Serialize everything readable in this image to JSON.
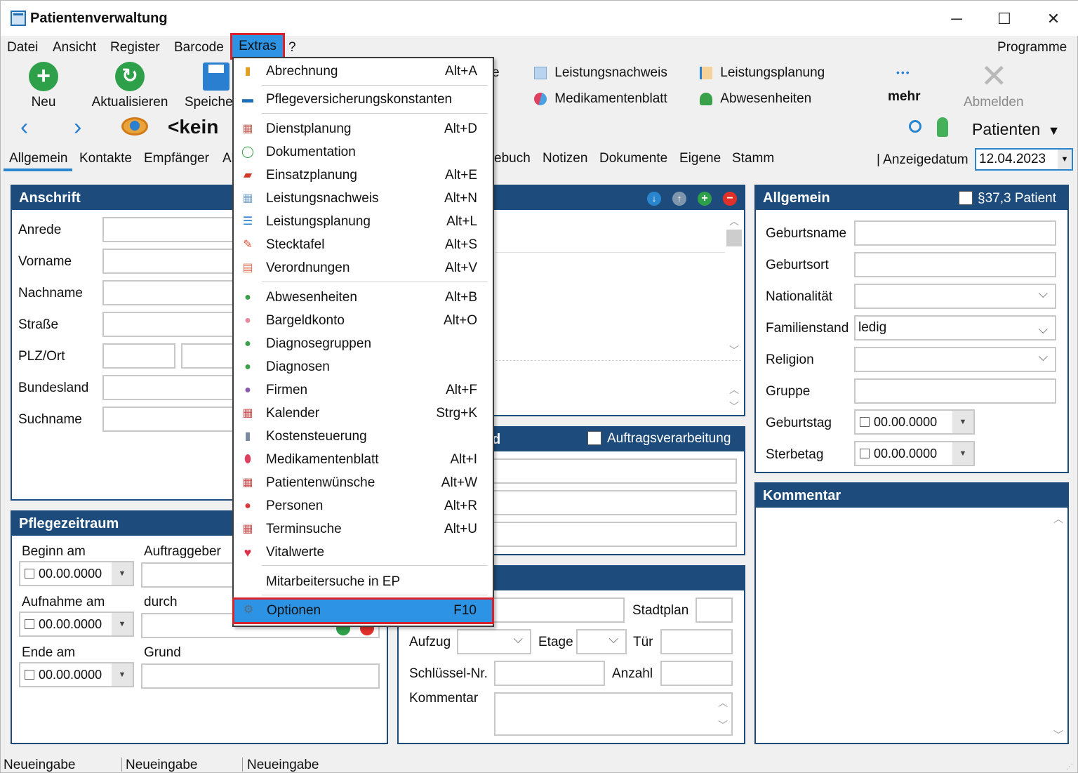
{
  "window": {
    "title": "Patientenverwaltung",
    "minimize": "─",
    "maximize": "☐",
    "close": "✕"
  },
  "menubar": {
    "items": [
      "Datei",
      "Ansicht",
      "Register",
      "Barcode",
      "Extras",
      "?"
    ],
    "programs": "Programme"
  },
  "toolbar": {
    "new_label": "Neu",
    "refresh_label": "Aktualisieren",
    "save_label": "Speiche",
    "leistungsnachweis": "Leistungsnachweis",
    "leistungsplanung": "Leistungsplanung",
    "medikamentenblatt": "Medikamentenblatt",
    "abwesenheiten": "Abwesenheiten",
    "partial_e": "e",
    "more_dots": "•••",
    "more_label": "mehr",
    "logout_label": "Abmelden",
    "record_label": "<kein",
    "patients_label": "Patienten",
    "display_date_label": "| Anzeigedatum",
    "display_date_value": "12.04.2023"
  },
  "tabs": [
    "Allgemein",
    "Kontakte",
    "Empfänger",
    "Al",
    "ebuch",
    "Notizen",
    "Dokumente",
    "Eigene",
    "Stamm"
  ],
  "anschrift": {
    "title": "Anschrift",
    "fields": [
      "Anrede",
      "Vorname",
      "Nachname",
      "Straße",
      "PLZ/Ort",
      "Bundesland",
      "Suchname"
    ]
  },
  "pflegezeitraum": {
    "title": "Pflegezeitraum",
    "beginn_label": "Beginn am",
    "auftraggeber_label": "Auftraggeber",
    "aufnahme_label": "Aufnahme am",
    "durch_label": "durch",
    "ende_label": "Ende am",
    "grund_label": "Grund",
    "date_placeholder": "00.00.0000"
  },
  "middle": {
    "panel2_title_partial": "d",
    "auftragsverarbeitung": "Auftragsverarbeitung",
    "stadtplan": "Stadtplan",
    "aufzug": "Aufzug",
    "etage": "Etage",
    "tuer": "Tür",
    "schluessel": "Schlüssel-Nr.",
    "anzahl": "Anzahl",
    "kommentar": "Kommentar"
  },
  "allgemein": {
    "title": "Allgemein",
    "patient_checkbox": "§37,3 Patient",
    "geburtsname": "Geburtsname",
    "geburtsort": "Geburtsort",
    "nationalitaet": "Nationalität",
    "familienstand": "Familienstand",
    "familienstand_value": "ledig",
    "religion": "Religion",
    "gruppe": "Gruppe",
    "geburtstag": "Geburtstag",
    "sterbetag": "Sterbetag",
    "date_placeholder": "00.00.0000"
  },
  "kommentar_panel": {
    "title": "Kommentar"
  },
  "extras_menu": [
    {
      "label": "Abrechnung",
      "shortcut": "Alt+A",
      "icon": "coins-icon"
    },
    {
      "label": "Pflegeversicherungskonstanten",
      "shortcut": "",
      "icon": "book-icon"
    },
    {
      "label": "Dienstplanung",
      "shortcut": "Alt+D",
      "icon": "calendar-icon"
    },
    {
      "label": "Dokumentation",
      "shortcut": "",
      "icon": "circle-icon"
    },
    {
      "label": "Einsatzplanung",
      "shortcut": "Alt+E",
      "icon": "car-icon"
    },
    {
      "label": "Leistungsnachweis",
      "shortcut": "Alt+N",
      "icon": "grid-icon"
    },
    {
      "label": "Leistungsplanung",
      "shortcut": "Alt+L",
      "icon": "list-icon"
    },
    {
      "label": "Stecktafel",
      "shortcut": "Alt+S",
      "icon": "pin-icon"
    },
    {
      "label": "Verordnungen",
      "shortcut": "Alt+V",
      "icon": "prescription-icon"
    },
    {
      "label": "Abwesenheiten",
      "shortcut": "Alt+B",
      "icon": "person-away-icon"
    },
    {
      "label": "Bargeldkonto",
      "shortcut": "Alt+O",
      "icon": "piggybank-icon"
    },
    {
      "label": "Diagnosegruppen",
      "shortcut": "",
      "icon": "diagnosis-group-icon"
    },
    {
      "label": "Diagnosen",
      "shortcut": "",
      "icon": "diagnosis-icon"
    },
    {
      "label": "Firmen",
      "shortcut": "Alt+F",
      "icon": "company-icon"
    },
    {
      "label": "Kalender",
      "shortcut": "Strg+K",
      "icon": "calendar2-icon"
    },
    {
      "label": "Kostensteuerung",
      "shortcut": "",
      "icon": "cost-icon"
    },
    {
      "label": "Medikamentenblatt",
      "shortcut": "Alt+I",
      "icon": "pill-icon"
    },
    {
      "label": "Patientenwünsche",
      "shortcut": "Alt+W",
      "icon": "wish-icon"
    },
    {
      "label": "Personen",
      "shortcut": "Alt+R",
      "icon": "person-icon"
    },
    {
      "label": "Terminsuche",
      "shortcut": "Alt+U",
      "icon": "search-calendar-icon"
    },
    {
      "label": "Vitalwerte",
      "shortcut": "",
      "icon": "heart-icon"
    },
    {
      "label": "Mitarbeitersuche in EP",
      "shortcut": "",
      "icon": ""
    },
    {
      "label": "Optionen",
      "shortcut": "F10",
      "icon": "gear-icon"
    }
  ],
  "statusbar": [
    "Neueingabe",
    "Neueingabe",
    "Neueingabe"
  ],
  "colors": {
    "panel_header": "#1d4c7c",
    "highlight": "#2c93e5",
    "annotation_red": "#d9222b",
    "accent_green": "#2ea04a"
  }
}
